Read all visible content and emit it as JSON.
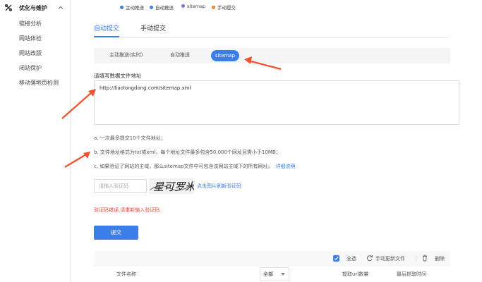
{
  "sidebar": {
    "title": "优化与维护",
    "items": [
      {
        "label": "链接分析"
      },
      {
        "label": "网站体检"
      },
      {
        "label": "网站改版"
      },
      {
        "label": "闭站保护"
      },
      {
        "label": "移动落地页检测"
      }
    ]
  },
  "legend": [
    {
      "label": "主动推送",
      "color": "#3b7de9"
    },
    {
      "label": "自动推送",
      "color": "#3b7de9"
    },
    {
      "label": "sitemap",
      "color": "#8e6ad8"
    },
    {
      "label": "手动提交",
      "color": "#f07c3a"
    }
  ],
  "main_tabs": [
    {
      "label": "自动提交",
      "active": true
    },
    {
      "label": "手动提交",
      "active": false
    }
  ],
  "sub_tabs": [
    {
      "label": "主动推送(实时)"
    },
    {
      "label": "自动推送"
    },
    {
      "label": "sitemap",
      "active": true
    }
  ],
  "form": {
    "field_label": "请填写数据文件地址",
    "url_value": "http://liaolongdong.com/sitemap.xml",
    "notes": [
      "a. 一次最多提交10个文件地址；",
      "b. 文件地址格式为txt或xml，每个地址文件最多包含50,000个网址且需小于10MB；",
      "c. 如果验证了网站的主域，那么sitemap文件中可包含该网站主域下的所有网址。"
    ],
    "note_c_link": "详细说明",
    "captcha_placeholder": "请输入验证码",
    "captcha_text": "星可罗米",
    "captcha_refresh": "点击图片刷新验证码",
    "error_message": "验证码错误,请重新输入验证码",
    "submit_label": "提交"
  },
  "table": {
    "toolbar": {
      "select_all": "全选",
      "manual_update": "手动更新文件",
      "delete": "删除"
    },
    "headers": {
      "file_name": "文件名称",
      "filter_value": "全部",
      "url_count": "提取url数量",
      "last_fetch": "最后抓取时间"
    }
  },
  "colors": {
    "accent": "#3b7de9",
    "error": "#e8463a",
    "annotation_arrow": "#f0522d"
  }
}
